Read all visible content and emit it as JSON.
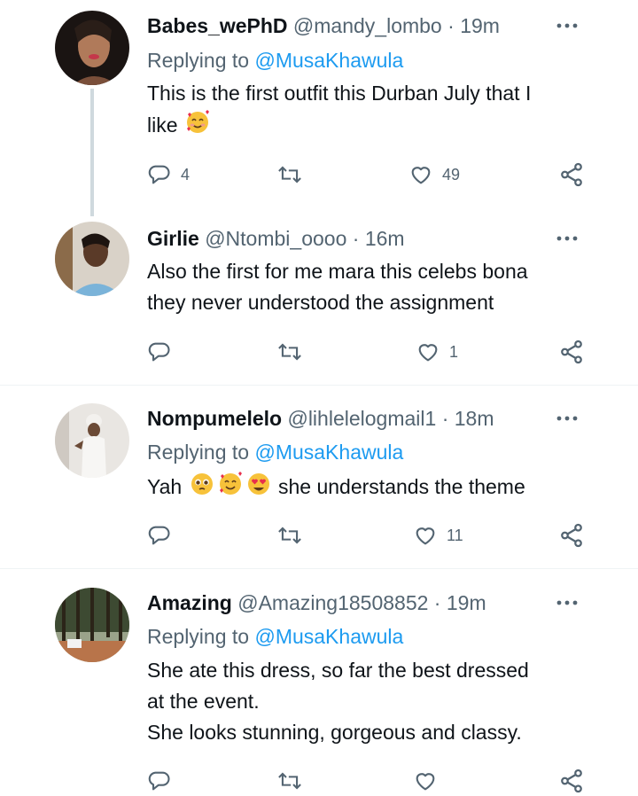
{
  "tweets": [
    {
      "name": "Babes_wePhD",
      "handle": "@mandy_lombo",
      "time": "19m",
      "replying_label": "Replying to",
      "replying_to": "@MusaKhawula",
      "text_lines": [
        "This is the first outfit this Durban July that I",
        "like"
      ],
      "emojis": [
        "smiling-face-with-hearts"
      ],
      "reply_count": "4",
      "retweet_count": "",
      "like_count": "49"
    },
    {
      "name": "Girlie",
      "handle": "@Ntombi_oooo",
      "time": "16m",
      "text_lines": [
        "Also the first for me mara this celebs bona",
        "they never understood the assignment"
      ],
      "reply_count": "",
      "retweet_count": "",
      "like_count": "1"
    },
    {
      "name": "Nompumelelo",
      "handle": "@lihlelelogmail1",
      "time": "18m",
      "replying_label": "Replying to",
      "replying_to": "@MusaKhawula",
      "text_prefix": "Yah",
      "text_suffix": "she understands the theme",
      "emojis": [
        "pleading-face",
        "smiling-face-with-hearts",
        "heart-eyes"
      ],
      "reply_count": "",
      "retweet_count": "",
      "like_count": "11"
    },
    {
      "name": "Amazing",
      "handle": "@Amazing18508852",
      "time": "19m",
      "replying_label": "Replying to",
      "replying_to": "@MusaKhawula",
      "text_lines": [
        "She ate this dress, so far the best dressed",
        "at the event.",
        "She looks stunning, gorgeous and classy."
      ]
    }
  ],
  "separator": "·",
  "colors": {
    "text": "#0f1419",
    "secondary": "#536471",
    "link": "#1d9bf0",
    "divider": "#eff3f4",
    "thread_line": "#cfd9de"
  },
  "icons": [
    "more-icon",
    "reply-icon",
    "retweet-icon",
    "like-icon",
    "share-icon"
  ]
}
